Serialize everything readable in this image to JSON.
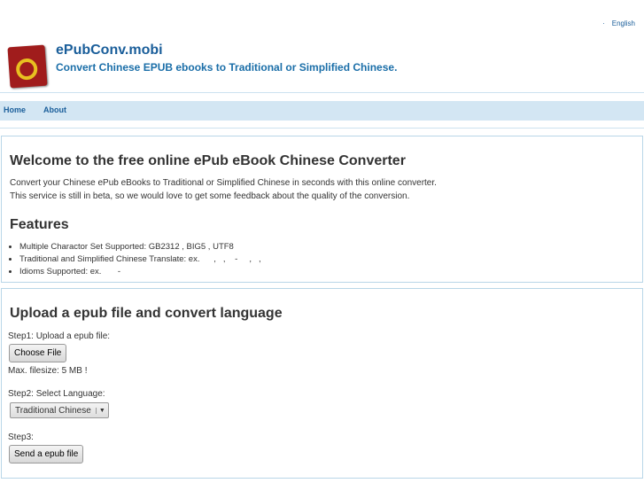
{
  "lang": {
    "items": [
      "",
      "English"
    ]
  },
  "header": {
    "title": "ePubConv.mobi",
    "subtitle": "Convert Chinese EPUB ebooks to Traditional or Simplified Chinese.",
    "logo_text": "ePubConv"
  },
  "nav": {
    "items": [
      "Home",
      "About"
    ]
  },
  "welcome": {
    "title": "Welcome to the free online ePub eBook Chinese Converter",
    "line1": "Convert your Chinese ePub eBooks to Traditional or Simplified Chinese in seconds with this online converter.",
    "line2": "This service is still in beta, so we would love to get some feedback about the quality of the conversion.",
    "features_title": "Features",
    "features": [
      "Multiple Charactor Set Supported: GB2312 , BIG5 , UTF8",
      "Traditional and Simplified Chinese Translate: ex.      ,   ,    -     ,   ,",
      "Idioms Supported: ex.       -"
    ]
  },
  "upload": {
    "title": "Upload a epub file and convert language",
    "step1": "Step1: Upload a epub file:",
    "choose": "Choose File",
    "max": "Max. filesize: 5 MB !",
    "step2": "Step2: Select Language:",
    "language": "Traditional Chinese",
    "step3": "Step3:",
    "send": "Send a epub file"
  }
}
